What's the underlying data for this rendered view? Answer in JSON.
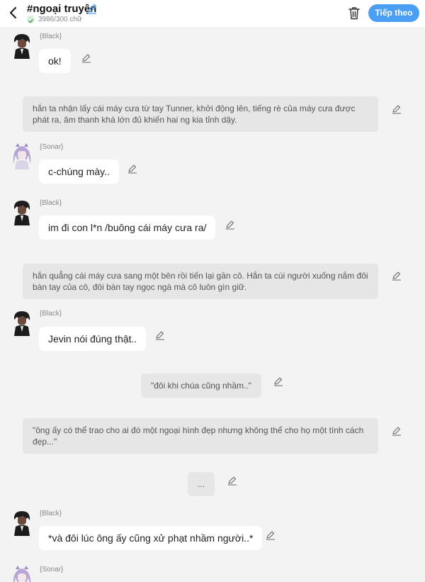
{
  "header": {
    "title": "#ngoại truyện",
    "word_count": "3986/300 chữ",
    "next_label": "Tiếp theo",
    "accent_color": "#4a9ff5"
  },
  "messages": [
    {
      "type": "dialogue",
      "speaker": "{Black}",
      "text": "ok!",
      "avatar": "black-haired-character"
    },
    {
      "type": "narration",
      "text": "hắn ta nhận lấy cái máy cưa từ tay Tunner, khởi động lên, tiếng rè của máy cưa được phát ra, âm thanh khá lớn đủ khiến hai ng kia tỉnh dậy."
    },
    {
      "type": "dialogue",
      "speaker": "{Sonar}",
      "text": "c-chúng mày..",
      "avatar": "lavender-haired-character"
    },
    {
      "type": "dialogue",
      "speaker": "{Black}",
      "text": "im đi con l*n /buông cái máy cưa ra/",
      "avatar": "black-haired-character"
    },
    {
      "type": "narration",
      "text": "hắn quẳng cái máy cưa sang một bên rồi tiến lại gần cô. Hắn ta cúi người xuống nắm đôi bàn tay của cô, đôi bàn tay ngọc ngà mà cô luôn gìn giữ."
    },
    {
      "type": "dialogue",
      "speaker": "{Black}",
      "text": "Jevin nói đúng thật..",
      "avatar": "black-haired-character"
    },
    {
      "type": "center",
      "text": "\"đôi khi chúa cũng nhầm..\""
    },
    {
      "type": "narration",
      "text": "\"ông ấy có thể trao cho ai đó một ngoại hình đẹp nhưng không thể cho họ một tính cách đẹp...\""
    },
    {
      "type": "center",
      "text": "..."
    },
    {
      "type": "dialogue",
      "speaker": "{Black}",
      "text": "*và đôi lúc ông ấy cũng xử phạt nhầm người..*",
      "avatar": "black-haired-character"
    },
    {
      "type": "dialogue",
      "speaker": "{Sonar}",
      "text": "",
      "avatar": "lavender-haired-character"
    }
  ]
}
